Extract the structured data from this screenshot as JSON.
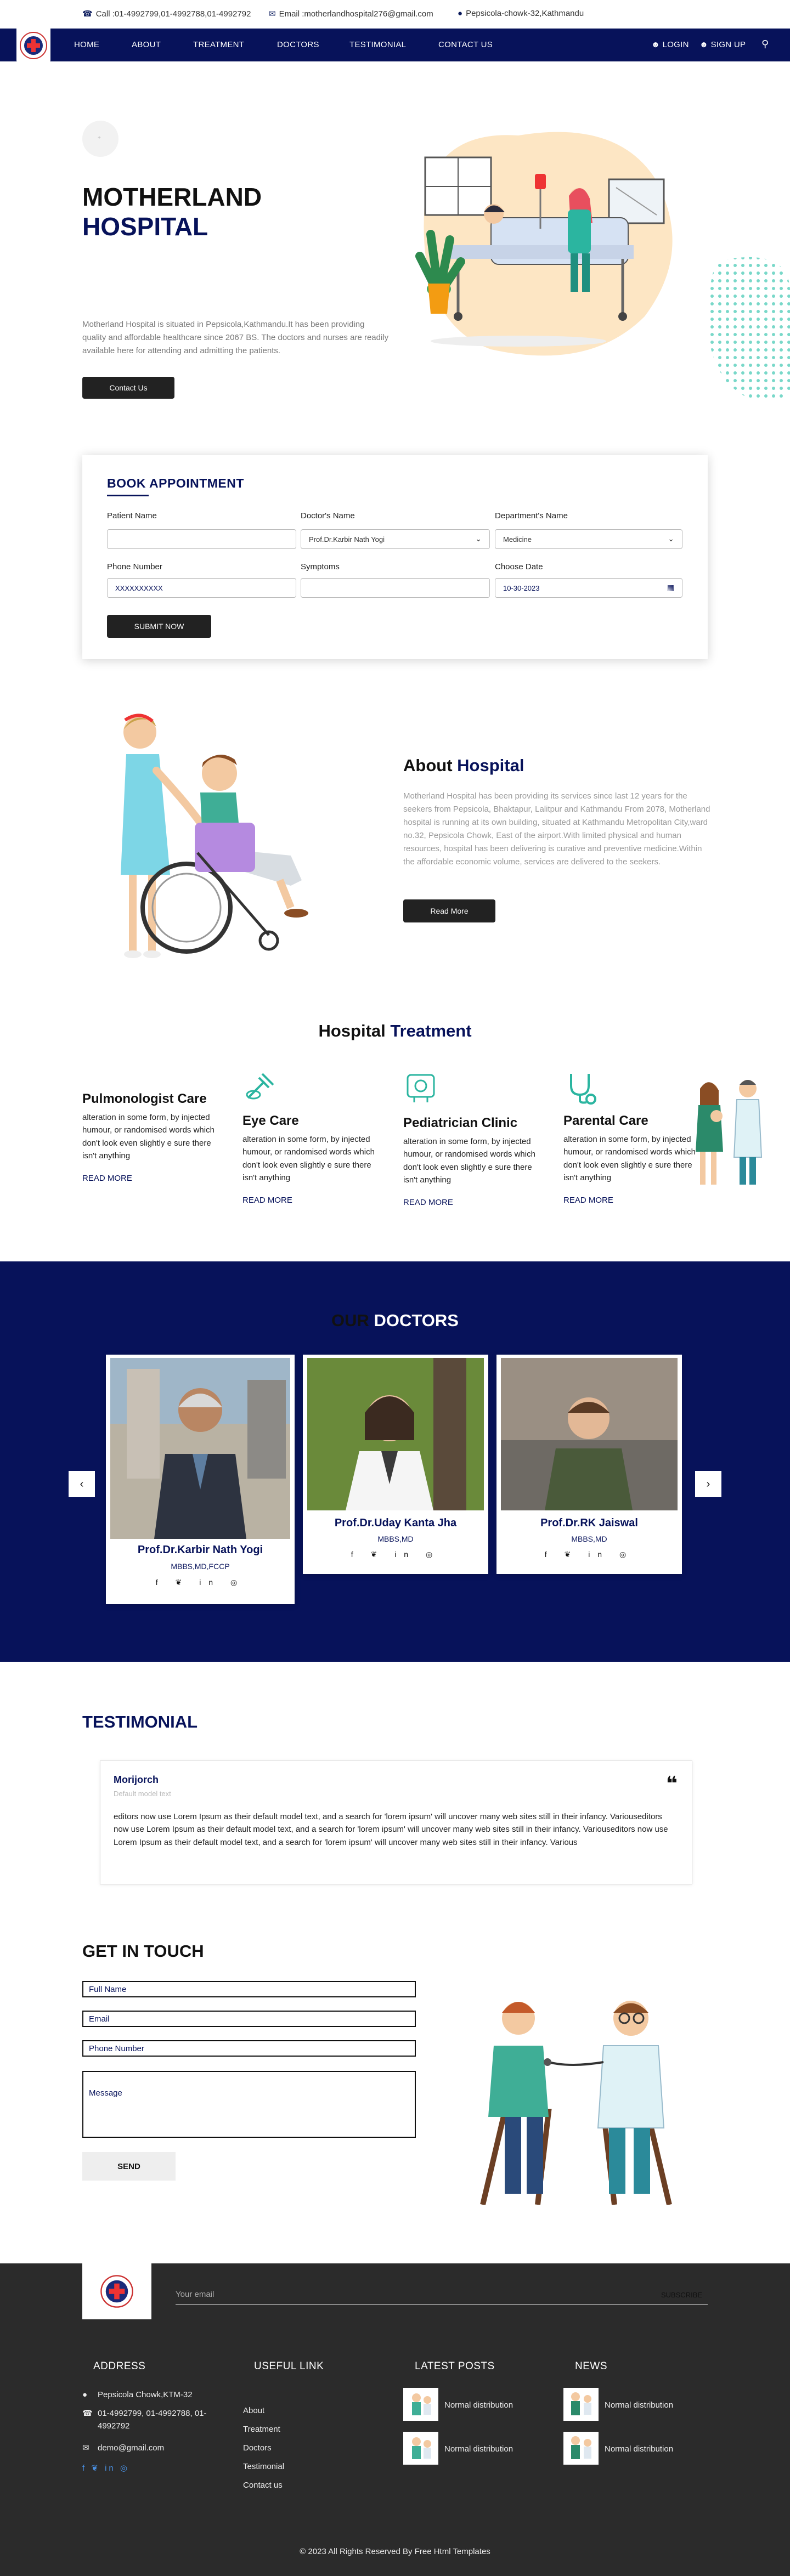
{
  "topbar": {
    "call": "Call :01-4992799,01-4992788,01-4992792",
    "email": "Email :motherlandhospital276@gmail.com",
    "address": "Pepsicola-chowk-32,Kathmandu"
  },
  "nav": {
    "items": [
      "HOME",
      "ABOUT",
      "TREATMENT",
      "DOCTORS",
      "TESTIMONIAL",
      "CONTACT US"
    ],
    "login": "LOGIN",
    "signup": "SIGN UP"
  },
  "hero": {
    "title_line1": "MOTHERLAND",
    "title_line2": "HOSPITAL",
    "description": "Motherland Hospital is situated in Pepsicola,Kathmandu.It has been providing quality and affordable healthcare since 2067 BS. The doctors and nurses are readily available here for attending and admitting the patients.",
    "button": "Contact Us"
  },
  "booking": {
    "title": "BOOK APPOINTMENT",
    "patient_label": "Patient Name",
    "doctor_label": "Doctor's Name",
    "doctor_value": "Prof.Dr.Karbir Nath Yogi",
    "department_label": "Department's Name",
    "department_value": "Medicine",
    "phone_label": "Phone Number",
    "phone_placeholder": "XXXXXXXXXX",
    "symptoms_label": "Symptoms",
    "date_label": "Choose Date",
    "date_value": "10-30-2023",
    "submit": "SUBMIT NOW"
  },
  "about": {
    "title_a": "About",
    "title_b": "Hospital",
    "text": "Motherland Hospital has been providing its services since last 12 years for the seekers from Pepsicola, Bhaktapur, Lalitpur and Kathmandu From 2078, Motherland hospital is running at its own building, situated at Kathmandu Metropolitan City,ward no.32, Pepsicola Chowk, East of the airport.With limited physical and human resources, hospital has been delivering is curative and preventive medicine.Within the affordable economic volume, services are delivered to the seekers.",
    "button": "Read More"
  },
  "treatment": {
    "title_a": "Hospital",
    "title_b": "Treatment",
    "items": [
      {
        "title": "Pulmonologist Care",
        "text": "alteration in some form, by injected humour, or randomised words which don't look even slightly e sure there isn't anything",
        "link": "READ MORE"
      },
      {
        "title": "Eye Care",
        "text": "alteration in some form, by injected humour, or randomised words which don't look even slightly e sure there isn't anything",
        "link": "READ MORE"
      },
      {
        "title": "Pediatrician Clinic",
        "text": "alteration in some form, by injected humour, or randomised words which don't look even slightly e sure there isn't anything",
        "link": "READ MORE"
      },
      {
        "title": "Parental Care",
        "text": "alteration in some form, by injected humour, or randomised words which don't look even slightly e sure there isn't anything",
        "link": "READ MORE"
      }
    ]
  },
  "doctors": {
    "title_a": "OUR",
    "title_b": "DOCTORS",
    "cards": [
      {
        "name": "Prof.Dr.Karbir Nath Yogi",
        "degree": "MBBS,MD,FCCP"
      },
      {
        "name": "Prof.Dr.Uday Kanta Jha",
        "degree": "MBBS,MD"
      },
      {
        "name": "Prof.Dr.RK Jaiswal",
        "degree": "MBBS,MD"
      }
    ],
    "social": "f ❦ in ◎"
  },
  "testimonial": {
    "title": "TESTIMONIAL",
    "name": "Morijorch",
    "role": "Default model text",
    "quote": "editors now use Lorem Ipsum as their default model text, and a search for 'lorem ipsum' will uncover many web sites still in their infancy. Variouseditors now use Lorem Ipsum as their default model text, and a search for 'lorem ipsum' will uncover many web sites still in their infancy. Variouseditors now use Lorem Ipsum as their default model text, and a search for 'lorem ipsum' will uncover many web sites still in their infancy. Various"
  },
  "contact": {
    "title": "GET IN TOUCH",
    "full_name": "Full Name",
    "email": "Email",
    "phone": "Phone Number",
    "message": "Message",
    "send": "SEND"
  },
  "footer": {
    "email_placeholder": "Your email",
    "subscribe": "SUBSCRIBE",
    "address_title": "ADDRESS",
    "address": "Pepsicola Chowk,KTM-32",
    "phones": "01-4992799, 01-4992788, 01-4992792",
    "mail": "demo@gmail.com",
    "social": "f ❦ in ◎",
    "links_title": "USEFUL LINK",
    "links": [
      "About",
      "Treatment",
      "Doctors",
      "Testimonial",
      "Contact us"
    ],
    "posts_title": "LATEST POSTS",
    "posts": [
      "Normal distribution",
      "Normal distribution"
    ],
    "news_title": "NEWS",
    "news": [
      "Normal distribution",
      "Normal distribution"
    ],
    "copyright": "© 2023 All Rights Reserved By Free Html Templates"
  },
  "colors": {
    "navy": "#07125a",
    "dark": "#222222",
    "teal": "#2bb5a0",
    "footer": "#2b2b2b"
  }
}
